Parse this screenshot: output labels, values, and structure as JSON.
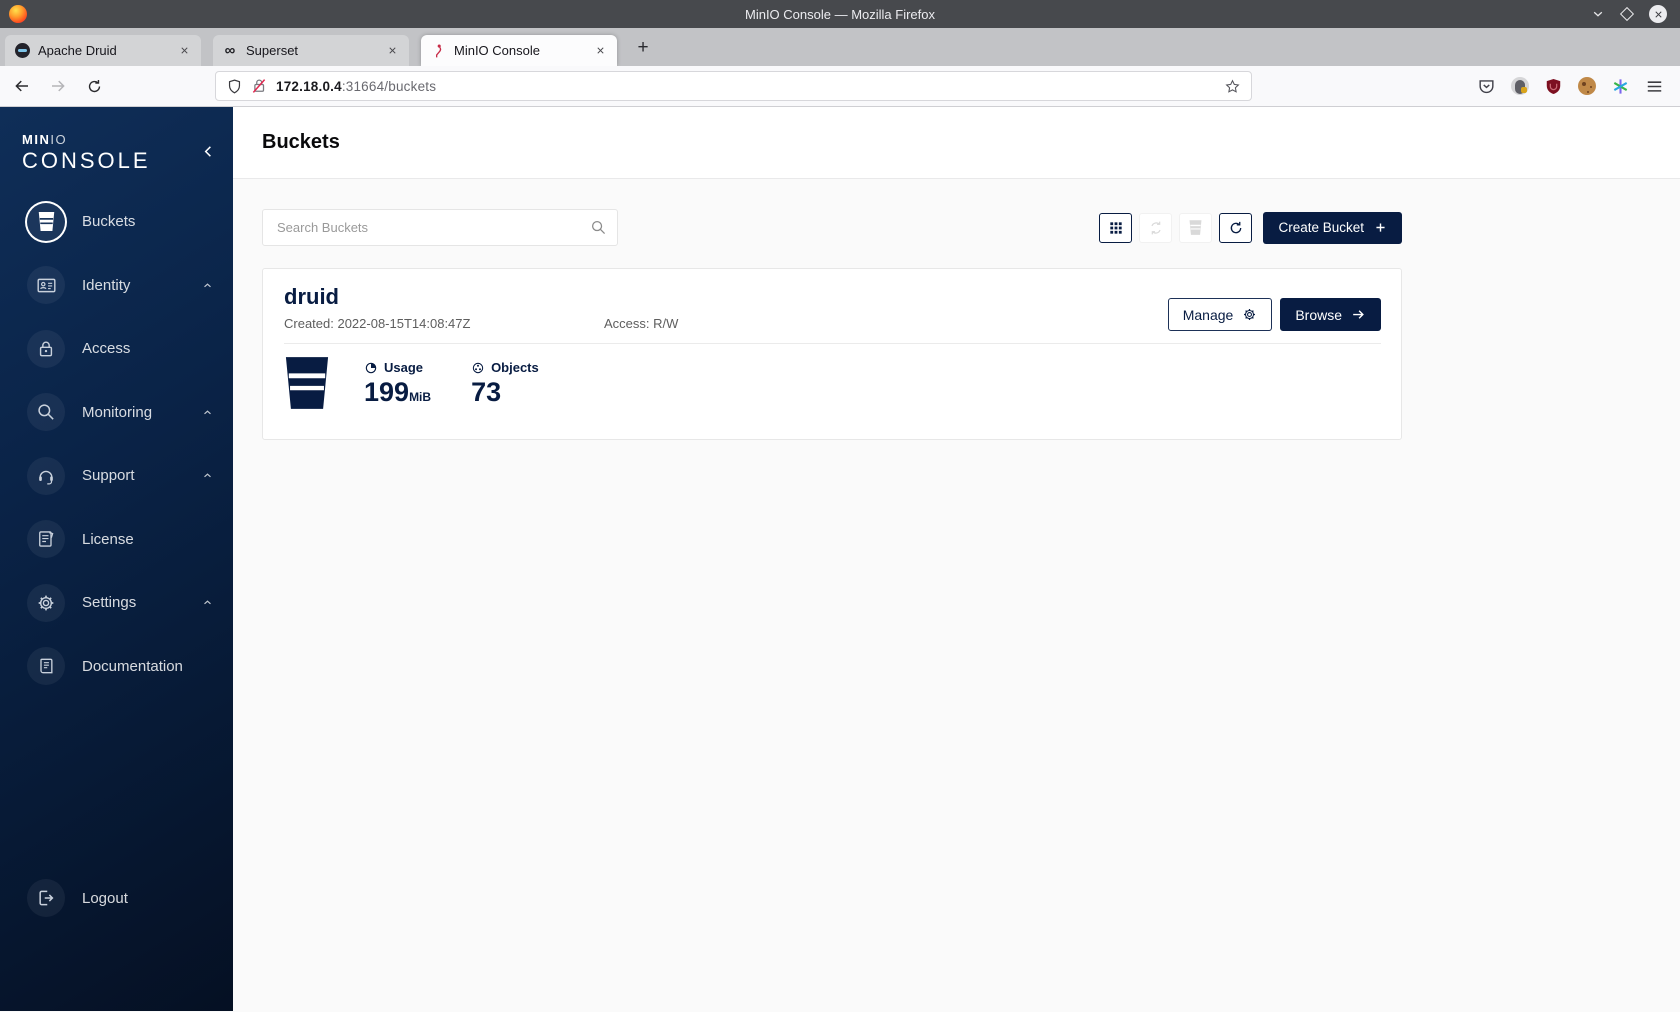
{
  "window": {
    "title": "MinIO Console — Mozilla Firefox"
  },
  "tabs": [
    {
      "title": "Apache Druid"
    },
    {
      "title": "Superset"
    },
    {
      "title": "MinIO Console"
    }
  ],
  "browser": {
    "url_host": "172.18.0.4",
    "url_rest": ":31664/buckets",
    "new_tab_glyph": "+",
    "superset_favicon_glyph": "∞"
  },
  "sidebar": {
    "logo_min": "MIN",
    "logo_io": "IO",
    "logo_console": "CONSOLE",
    "items": [
      {
        "label": "Buckets"
      },
      {
        "label": "Identity"
      },
      {
        "label": "Access"
      },
      {
        "label": "Monitoring"
      },
      {
        "label": "Support"
      },
      {
        "label": "License"
      },
      {
        "label": "Settings"
      },
      {
        "label": "Documentation"
      }
    ],
    "logout": {
      "label": "Logout"
    }
  },
  "page": {
    "title": "Buckets"
  },
  "toolbar": {
    "search_placeholder": "Search Buckets",
    "create_label": "Create Bucket"
  },
  "buckets": [
    {
      "name": "druid",
      "created": "Created: 2022-08-15T14:08:47Z",
      "access": "Access: R/W",
      "manage_label": "Manage",
      "browse_label": "Browse",
      "usage_label": "Usage",
      "usage_value": "199",
      "usage_unit": "MiB",
      "objects_label": "Objects",
      "objects_value": "73"
    }
  ],
  "colors": {
    "brand_navy": "#081C42",
    "sidebar_gradient_top": "#0F2E58",
    "sidebar_gradient_bottom": "#051023",
    "insecure_red": "#E22850"
  }
}
